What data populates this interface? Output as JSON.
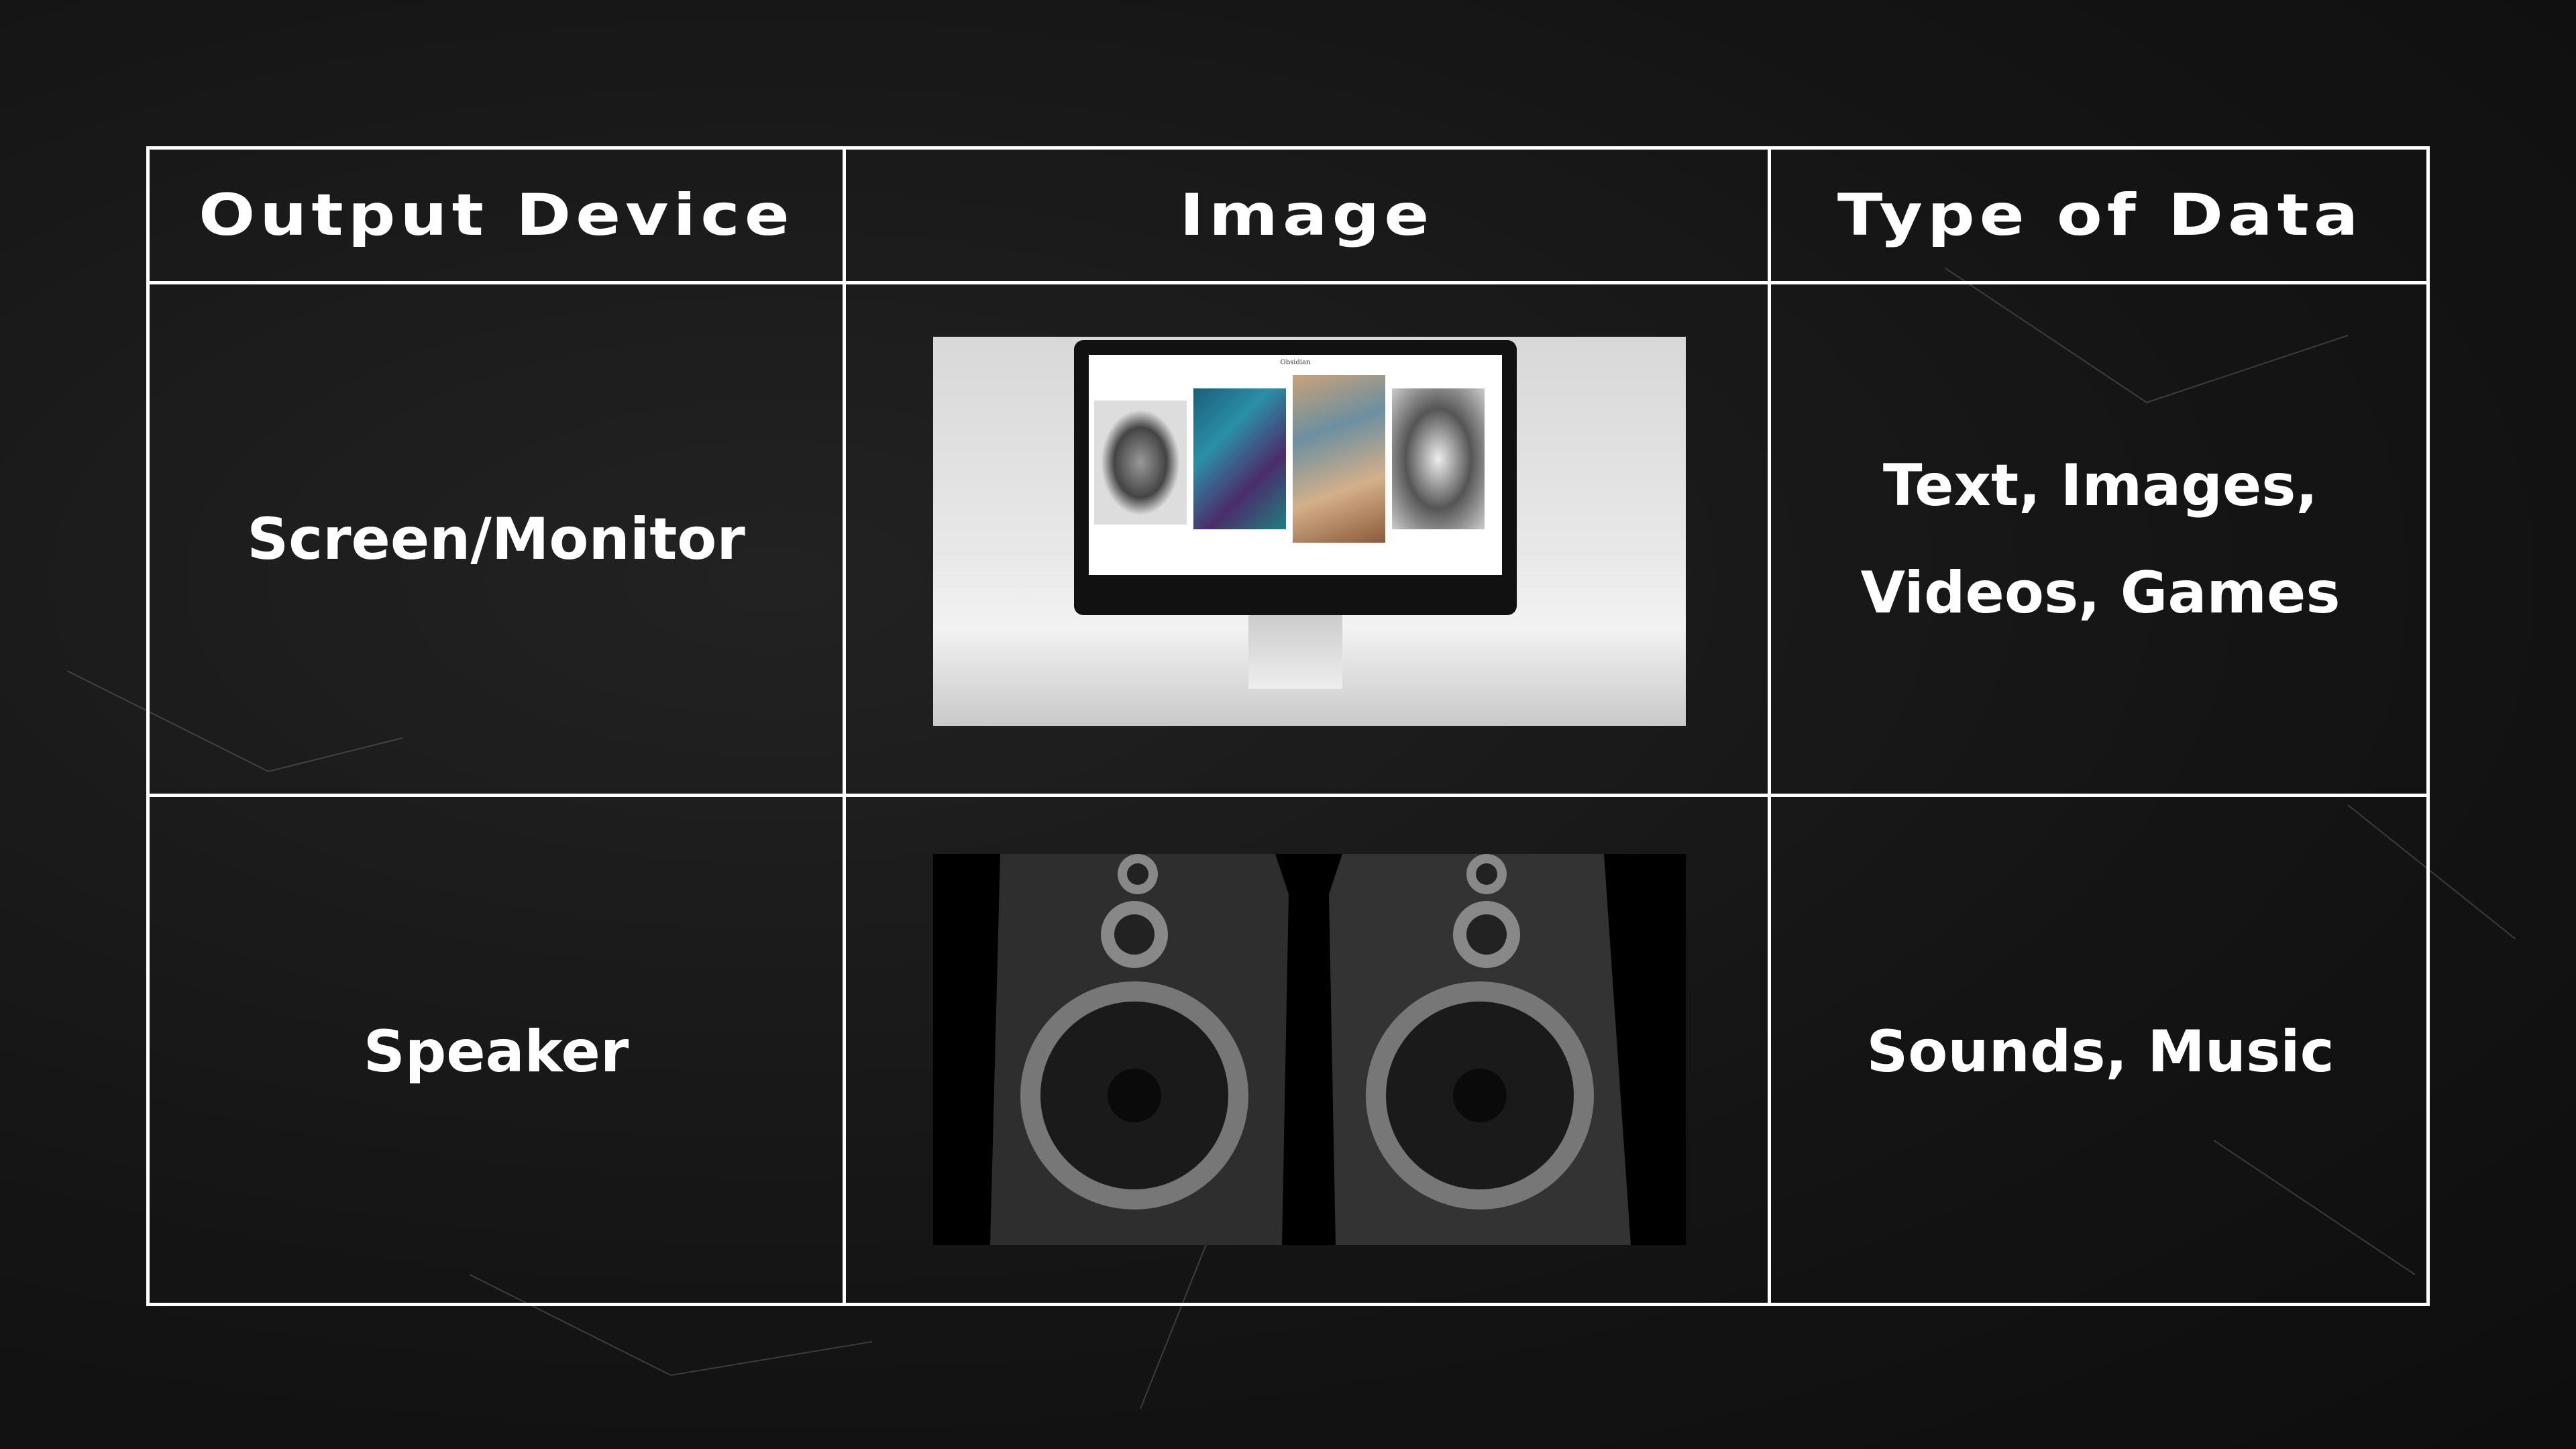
{
  "table": {
    "headers": [
      "Output Device",
      "Image",
      "Type of Data"
    ],
    "rows": [
      {
        "device": "Screen/Monitor",
        "image": "monitor-photo",
        "data_line1": "Text, Images,",
        "data_line2": "Videos, Games"
      },
      {
        "device": "Speaker",
        "image": "speakers-photo",
        "data_line1": "Sounds, Music"
      }
    ]
  },
  "monitor_screen": {
    "site_title": "Obsidian"
  }
}
